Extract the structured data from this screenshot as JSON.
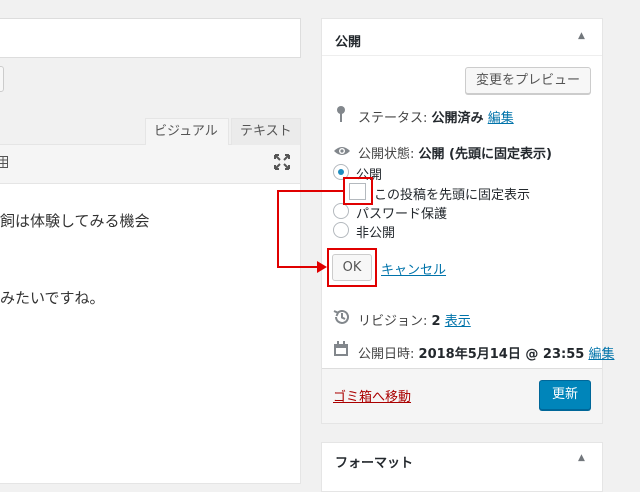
{
  "editor": {
    "tabs": [
      {
        "label": "ビジュアル",
        "active": true
      },
      {
        "label": "テキスト",
        "active": false
      }
    ],
    "content_lines": [
      "飼は体験してみる機会",
      "みたいですね。"
    ]
  },
  "publish": {
    "title": "公開",
    "preview_label": "変更をプレビュー",
    "status": {
      "label": "ステータス:",
      "value": "公開済み",
      "edit": "編集"
    },
    "visibility": {
      "label": "公開状態:",
      "value": "公開 (先頭に固定表示)"
    },
    "options": [
      {
        "label": "公開",
        "checked": true
      },
      {
        "label": "この投稿を先頭に固定表示",
        "checked": false
      },
      {
        "label": "パスワード保護",
        "checked": false
      },
      {
        "label": "非公開",
        "checked": false
      }
    ],
    "ok_label": "OK",
    "cancel_label": "キャンセル",
    "revisions": {
      "label": "リビジョン:",
      "count": "2",
      "link": "表示"
    },
    "published_on": {
      "label": "公開日時:",
      "value": "2018年5月14日 @ 23:55",
      "edit": "編集"
    },
    "trash_label": "ゴミ箱へ移動",
    "update_label": "更新"
  },
  "format_box": {
    "title": "フォーマット"
  },
  "colors": {
    "accent": "#0085ba",
    "annotation": "#e00000",
    "trash": "#aa0000",
    "link": "#0073aa"
  }
}
